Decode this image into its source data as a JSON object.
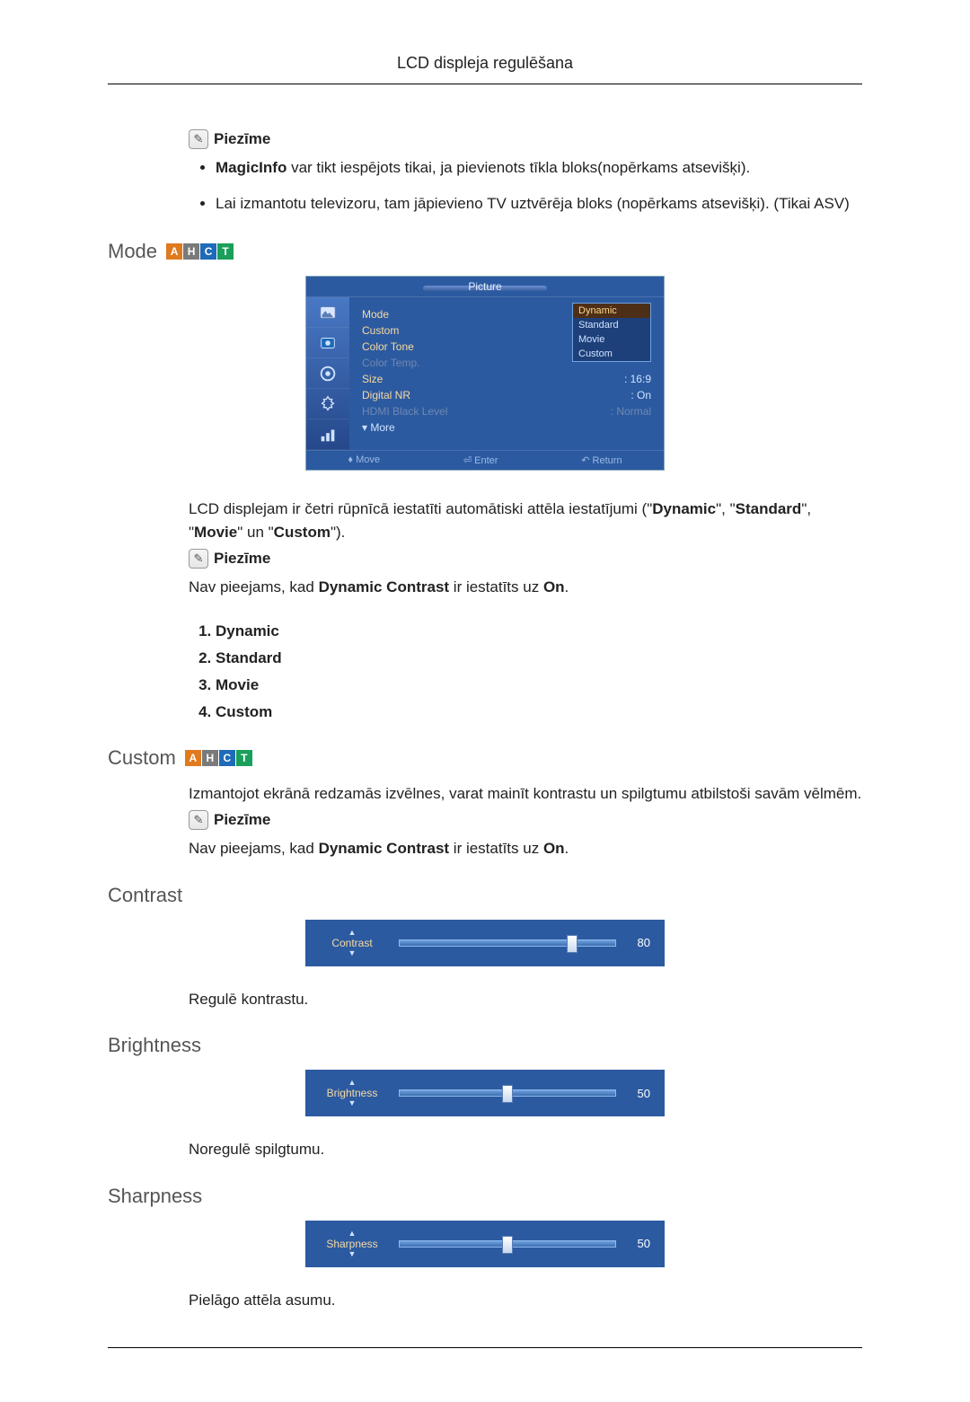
{
  "header": {
    "title": "LCD displeja regulēšana"
  },
  "note_label": "Piezīme",
  "bullets": [
    {
      "prefix_bold": "MagicInfo",
      "rest": " var tikt iespējots tikai, ja pievienots tīkla bloks(nopērkams atsevišķi)."
    },
    {
      "prefix_bold": "",
      "rest": "Lai izmantotu televizoru, tam jāpievieno TV uztvērēja bloks (nopērkams atsevišķi). (Tikai ASV)"
    }
  ],
  "mode": {
    "heading": "Mode",
    "osd": {
      "title": "Picture",
      "rows": [
        {
          "label": "Mode",
          "value": "",
          "dim": false
        },
        {
          "label": "Custom",
          "value": "",
          "dim": false
        },
        {
          "label": "Color Tone",
          "value": ":",
          "dim": false
        },
        {
          "label": "Color Temp.",
          "value": "",
          "dim": true
        },
        {
          "label": "Size",
          "value": ": 16:9",
          "dim": false
        },
        {
          "label": "Digital NR",
          "value": ": On",
          "dim": false
        },
        {
          "label": "HDMI Black Level",
          "value": ": Normal",
          "dim": true
        },
        {
          "label": "▾ More",
          "value": "",
          "dim": false,
          "more": true
        }
      ],
      "dropdown": [
        "Dynamic",
        "Standard",
        "Movie",
        "Custom"
      ],
      "dropdown_selected_index": 0,
      "footer": {
        "move": "Move",
        "enter": "Enter",
        "return": "Return"
      }
    },
    "description_parts": [
      "LCD displejam ir četri rūpnīcā iestatīti automātiski attēla iestatījumi (\"",
      "Dynamic",
      "\", \"",
      "Standard",
      "\", \"",
      "Movie",
      "\" un \"",
      "Custom",
      "\")."
    ],
    "note_text_parts": [
      "Nav pieejams, kad ",
      "Dynamic Contrast",
      " ir iestatīts uz ",
      "On",
      "."
    ],
    "list": [
      "Dynamic",
      "Standard",
      "Movie",
      "Custom"
    ]
  },
  "custom": {
    "heading": "Custom",
    "description": "Izmantojot ekrānā redzamās izvēlnes, varat mainīt kontrastu un spilgtumu atbilstoši savām vēlmēm.",
    "note_text_parts": [
      "Nav pieejams, kad ",
      "Dynamic Contrast",
      " ir iestatīts uz ",
      "On",
      "."
    ]
  },
  "contrast": {
    "heading": "Contrast",
    "slider": {
      "label": "Contrast",
      "value": 80,
      "pos": 80
    },
    "text": "Regulē kontrastu."
  },
  "brightness": {
    "heading": "Brightness",
    "slider": {
      "label": "Brightness",
      "value": 50,
      "pos": 50
    },
    "text": "Noregulē spilgtumu."
  },
  "sharpness": {
    "heading": "Sharpness",
    "slider": {
      "label": "Sharpness",
      "value": 50,
      "pos": 50
    },
    "text": "Pielāgo attēla asumu."
  }
}
